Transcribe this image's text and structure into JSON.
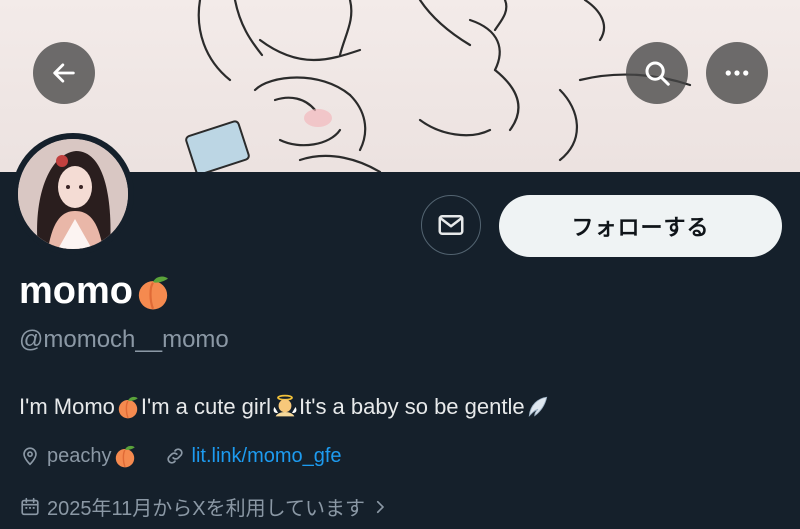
{
  "header": {
    "back_icon": "arrow-left-icon",
    "search_icon": "search-icon",
    "more_icon": "more-horizontal-icon"
  },
  "profile": {
    "display_name": "momo",
    "name_emoji": "peach-emoji",
    "handle": "@momoch__momo",
    "follow_label": "フォローする",
    "message_icon": "mail-icon",
    "bio": {
      "part1": "I'm Momo",
      "part2": "I'm a cute girl",
      "part3": " It's a baby so be gentle",
      "emojis": [
        "peach-emoji",
        "baby-angel-emoji",
        "wing-emoji"
      ]
    },
    "location": "peachy",
    "link": "lit.link/momo_gfe",
    "joined": "2025年11月からXを利用しています"
  },
  "colors": {
    "background": "#15202b",
    "link": "#1d9bf0",
    "secondary_text": "#8b98a5",
    "button_bg": "#eff3f4"
  }
}
